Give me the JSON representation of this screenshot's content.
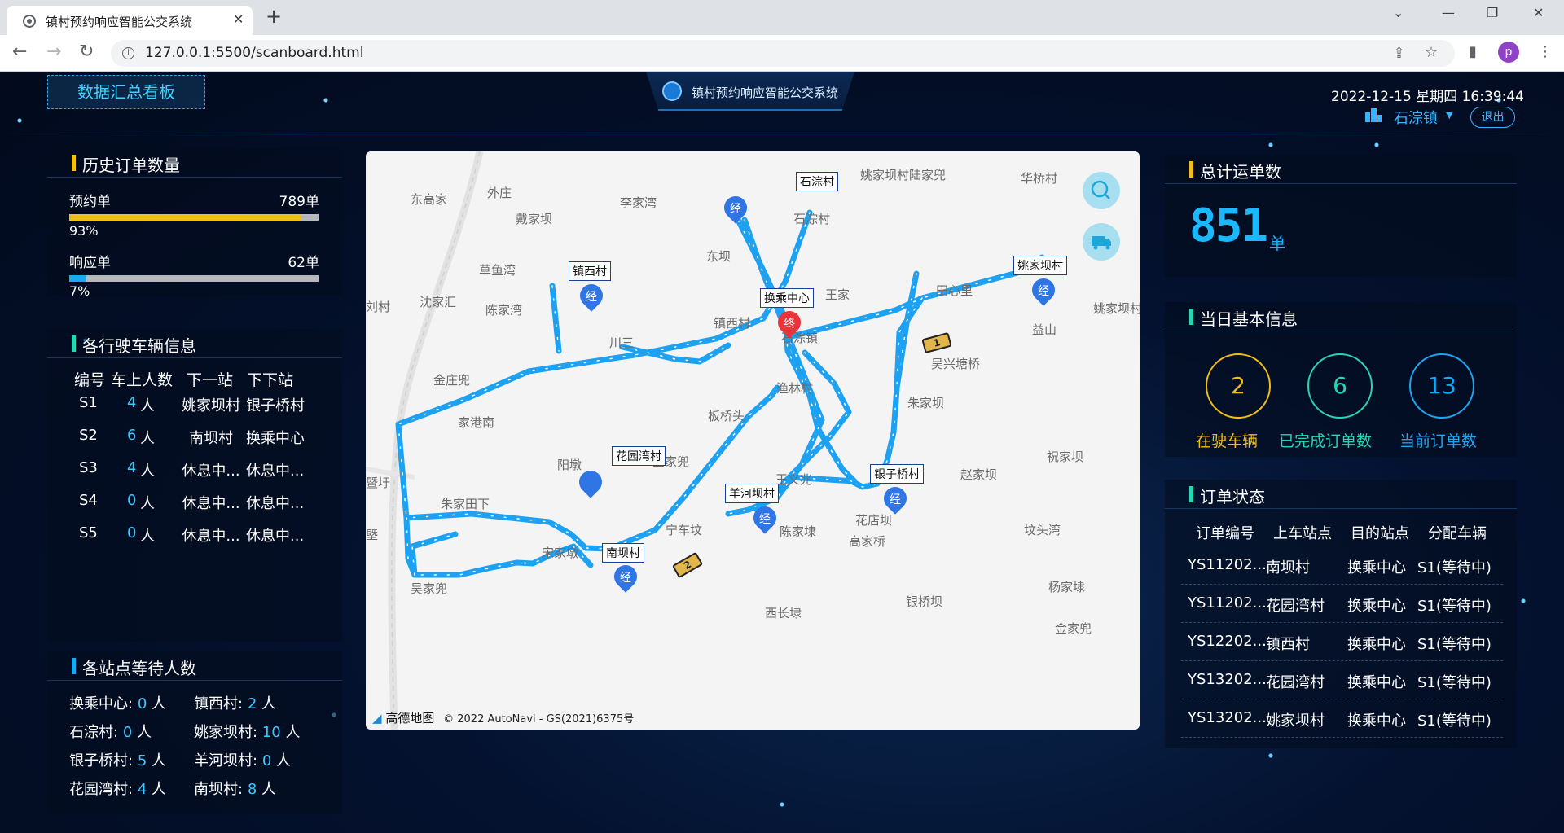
{
  "browser": {
    "tab_title": "镇村预约响应智能公交系统",
    "url": "127.0.0.1:5500/scanboard.html",
    "profile_initial": "p"
  },
  "header": {
    "dashboard_button": "数据汇总看板",
    "system_title": "镇村预约响应智能公交系统",
    "datetime": "2022-12-15  星期四  16:39:44",
    "town": "石淙镇",
    "logout": "退出"
  },
  "history": {
    "title": "历史订单数量",
    "reserve": {
      "label": "预约单",
      "value": "789单",
      "percent_label": "93%",
      "percent": 93,
      "color": "#f2c014"
    },
    "response": {
      "label": "响应单",
      "value": "62单",
      "percent_label": "7%",
      "percent": 7,
      "color": "#19a8f2"
    }
  },
  "vehicles": {
    "title": "各行驶车辆信息",
    "headers": [
      "编号",
      "车上人数",
      "下一站",
      "下下站"
    ],
    "rows": [
      {
        "id": "S1",
        "count": "4",
        "unit": "人",
        "next": "姚家坝村",
        "after": "银子桥村"
      },
      {
        "id": "S2",
        "count": "6",
        "unit": "人",
        "next": "南坝村",
        "after": "换乘中心"
      },
      {
        "id": "S3",
        "count": "4",
        "unit": "人",
        "next": "休息中...",
        "after": "休息中..."
      },
      {
        "id": "S4",
        "count": "0",
        "unit": "人",
        "next": "休息中...",
        "after": "休息中..."
      },
      {
        "id": "S5",
        "count": "0",
        "unit": "人",
        "next": "休息中...",
        "after": "休息中..."
      }
    ]
  },
  "stations": {
    "title": "各站点等待人数",
    "items": [
      {
        "name": "换乘中心:",
        "count": "0",
        "unit": "人"
      },
      {
        "name": "镇西村:",
        "count": "2",
        "unit": "人"
      },
      {
        "name": "石淙村:",
        "count": "0",
        "unit": "人"
      },
      {
        "name": "姚家坝村:",
        "count": "10",
        "unit": "人"
      },
      {
        "name": "银子桥村:",
        "count": "5",
        "unit": "人"
      },
      {
        "name": "羊河坝村:",
        "count": "0",
        "unit": "人"
      },
      {
        "name": "花园湾村:",
        "count": "4",
        "unit": "人"
      },
      {
        "name": "南坝村:",
        "count": "8",
        "unit": "人"
      }
    ]
  },
  "map": {
    "places": [
      "东高家",
      "外庄",
      "李家湾",
      "戴家坝",
      "姚家坝村陆家兜",
      "华桥村",
      "石淙村",
      "草鱼湾",
      "东坝",
      "沈家汇",
      "陈家湾",
      "田心里",
      "姚家坝村",
      "王家",
      "益山",
      "镇西村",
      "川三",
      "石淙镇",
      "吴兴塘桥",
      "金庄兜",
      "渔林村",
      "朱家坝",
      "家港南",
      "板桥头",
      "阳墩",
      "金家兜",
      "王义兆",
      "赵家坝",
      "祝家坝",
      "朱家田下",
      "宋家墩",
      "宁车坟",
      "陈家埭",
      "花店坝",
      "高家桥",
      "坟头湾",
      "吴家兜",
      "杨家埭",
      "银桥坝",
      "西长埭",
      "金家兜",
      "刘村",
      "暨圩",
      "塈"
    ],
    "stops": [
      {
        "label": "石淙村",
        "pin": "经"
      },
      {
        "label": "姚家坝村",
        "pin": "经"
      },
      {
        "label": "镇西村",
        "pin": "经"
      },
      {
        "label": "换乘中心",
        "pin": "终"
      },
      {
        "label": "花园湾村",
        "pin": ""
      },
      {
        "label": "银子桥村",
        "pin": "经"
      },
      {
        "label": "羊河坝村",
        "pin": "经"
      },
      {
        "label": "南坝村",
        "pin": "经"
      }
    ],
    "buses": [
      "1",
      "2"
    ],
    "brand": "高德地图",
    "copyright": "© 2022 AutoNavi - GS(2021)6375号",
    "route_color": "#1da1f2"
  },
  "total": {
    "title": "总计运单数",
    "value": "851",
    "unit": "单"
  },
  "today": {
    "title": "当日基本信息",
    "items": [
      {
        "value": "2",
        "label": "在驶车辆",
        "color": "#f2c014"
      },
      {
        "value": "6",
        "label": "已完成订单数",
        "color": "#27d6b4"
      },
      {
        "value": "13",
        "label": "当前订单数",
        "color": "#19a8f2"
      }
    ]
  },
  "orders": {
    "title": "订单状态",
    "headers": [
      "订单编号",
      "上车站点",
      "目的站点",
      "分配车辆"
    ],
    "rows": [
      {
        "id": "YS11202...",
        "from": "南坝村",
        "to": "换乘中心",
        "car": "S1(等待中)"
      },
      {
        "id": "YS11202...",
        "from": "花园湾村",
        "to": "换乘中心",
        "car": "S1(等待中)"
      },
      {
        "id": "YS12202...",
        "from": "镇西村",
        "to": "换乘中心",
        "car": "S1(等待中)"
      },
      {
        "id": "YS13202...",
        "from": "花园湾村",
        "to": "换乘中心",
        "car": "S1(等待中)"
      },
      {
        "id": "YS13202...",
        "from": "姚家坝村",
        "to": "换乘中心",
        "car": "S1(等待中)"
      }
    ]
  }
}
